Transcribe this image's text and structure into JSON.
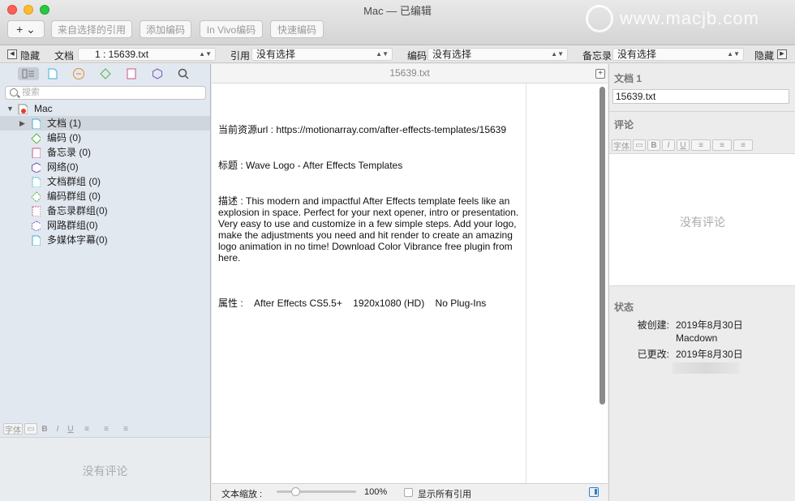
{
  "window": {
    "title": "Mac — 已编辑",
    "watermark": "www.macjb.com"
  },
  "toolbar": {
    "add_label": "+ ⌄",
    "buttons": [
      "来自选择的引用",
      "添加编码",
      "In Vivo编码",
      "快速编码"
    ]
  },
  "filterbar": {
    "hide_left": "隐藏",
    "doc_label": "文档",
    "doc_value": "1 : 15639.txt",
    "quote_label": "引用",
    "quote_value": "没有选择",
    "code_label": "编码",
    "code_value": "没有选择",
    "memo_label": "备忘录",
    "memo_value": "没有选择",
    "hide_right": "隐藏"
  },
  "sidebar": {
    "search_placeholder": "搜索",
    "root": "Mac",
    "items": [
      {
        "label": "文档 (1)",
        "icon": "document-icon",
        "color": "#3ab0d6"
      },
      {
        "label": "编码 (0)",
        "icon": "code-icon",
        "color": "#5bb14a"
      },
      {
        "label": "备忘录 (0)",
        "icon": "memo-icon",
        "color": "#d0508a"
      },
      {
        "label": "网络(0)",
        "icon": "network-icon",
        "color": "#7a58c0"
      },
      {
        "label": "文档群组 (0)",
        "icon": "document-group-icon",
        "color": "#3ab0d6"
      },
      {
        "label": "编码群组 (0)",
        "icon": "code-group-icon",
        "color": "#5bb14a"
      },
      {
        "label": "备忘录群组(0)",
        "icon": "memo-group-icon",
        "color": "#d0508a"
      },
      {
        "label": "网路群组(0)",
        "icon": "network-group-icon",
        "color": "#7a58c0"
      },
      {
        "label": "多媒体字幕(0)",
        "icon": "media-subtitle-icon",
        "color": "#3ab0d6"
      }
    ],
    "format_font": "字体",
    "no_comment": "没有评论"
  },
  "document": {
    "header": "15639.txt",
    "line1": "当前资源url : https://motionarray.com/after-effects-templates/15639",
    "line2": "标题 : Wave Logo - After Effects Templates",
    "line3": "描述 : This modern and impactful After Effects template feels like an explosion in space. Perfect for your next opener, intro or presentation. Very easy to use and customize in a few simple steps. Add your logo, make the adjustments you need and hit render to create an amazing logo animation in no time! Download Color Vibrance free plugin from here.",
    "line4": "属性 :    After Effects CS5.5+    1920x1080 (HD)    No Plug-Ins"
  },
  "bottom": {
    "zoom_label": "文本缩放 :",
    "zoom_value": "100%",
    "zoom_level_percent": 23,
    "show_quotes": "显示所有引用"
  },
  "inspector": {
    "doc_title": "文档 1",
    "doc_name": "15639.txt",
    "comment_label": "评论",
    "format_font": "字体",
    "no_comment": "没有评论",
    "status_label": "状态",
    "created_label": "被创建:",
    "created_value": "2019年8月30日",
    "created_by": "Macdown",
    "modified_label": "已更改:",
    "modified_value": "2019年8月30日"
  }
}
